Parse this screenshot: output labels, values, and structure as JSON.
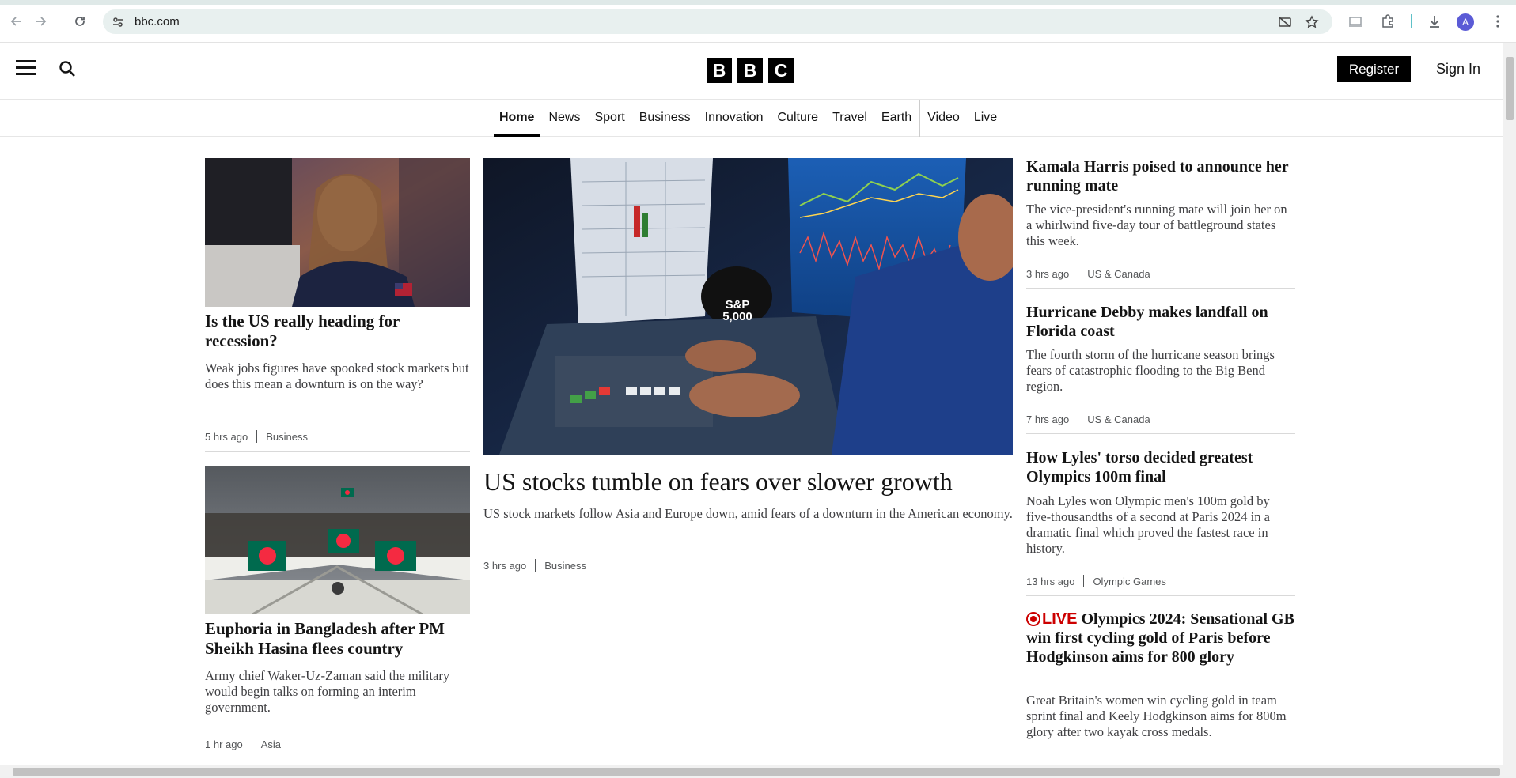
{
  "browser": {
    "url": "bbc.com",
    "colors": {
      "omnibox": "#e8f0ef",
      "accent": "#5fc1c8",
      "avatar": "#5b5bd6"
    },
    "profile_initial": "A"
  },
  "header": {
    "logo": [
      "B",
      "B",
      "C"
    ],
    "register_label": "Register",
    "signin_label": "Sign In"
  },
  "nav": {
    "items": [
      {
        "label": "Home",
        "active": true
      },
      {
        "label": "News"
      },
      {
        "label": "Sport"
      },
      {
        "label": "Business"
      },
      {
        "label": "Innovation"
      },
      {
        "label": "Culture"
      },
      {
        "label": "Travel"
      },
      {
        "label": "Earth"
      },
      {
        "label": "Video"
      },
      {
        "label": "Live"
      }
    ]
  },
  "stories": {
    "left_top": {
      "headline": "Is the US really heading for recession?",
      "summary": "Weak jobs figures have spooked stock markets but does this mean a downturn is on the way?",
      "time": "5 hrs ago",
      "section": "Business"
    },
    "left_bottom": {
      "headline": "Euphoria in Bangladesh after PM Sheikh Hasina flees country",
      "summary": "Army chief Waker-Uz-Zaman said the military would begin talks on forming an interim government.",
      "time": "1 hr ago",
      "section": "Asia"
    },
    "lead": {
      "headline": "US stocks tumble on fears over slower growth",
      "summary": "US stock markets follow Asia and Europe down, amid fears of a downturn in the American economy.",
      "time": "3 hrs ago",
      "section": "Business",
      "cap_text": "S&P 5,000"
    },
    "right": [
      {
        "headline": "Kamala Harris poised to announce her running mate",
        "summary": "The vice-president's running mate will join her on a whirlwind five-day tour of battleground states this week.",
        "time": "3 hrs ago",
        "section": "US & Canada"
      },
      {
        "headline": "Hurricane Debby makes landfall on Florida coast",
        "summary": "The fourth storm of the hurricane season brings fears of catastrophic flooding to the Big Bend region.",
        "time": "7 hrs ago",
        "section": "US & Canada"
      },
      {
        "headline": "How Lyles' torso decided greatest Olympics 100m final",
        "summary": "Noah Lyles won Olympic men's 100m gold by five-thousandths of a second at Paris 2024 in a dramatic final which proved the fastest race in history.",
        "time": "13 hrs ago",
        "section": "Olympic Games"
      },
      {
        "live_label": "LIVE",
        "headline": "Olympics 2024: Sensational GB win first cycling gold of Paris before Hodgkinson aims for 800 glory",
        "summary": "Great Britain's women win cycling gold in team sprint final and Keely Hodgkinson aims for 800m glory after two kayak cross medals."
      }
    ]
  }
}
